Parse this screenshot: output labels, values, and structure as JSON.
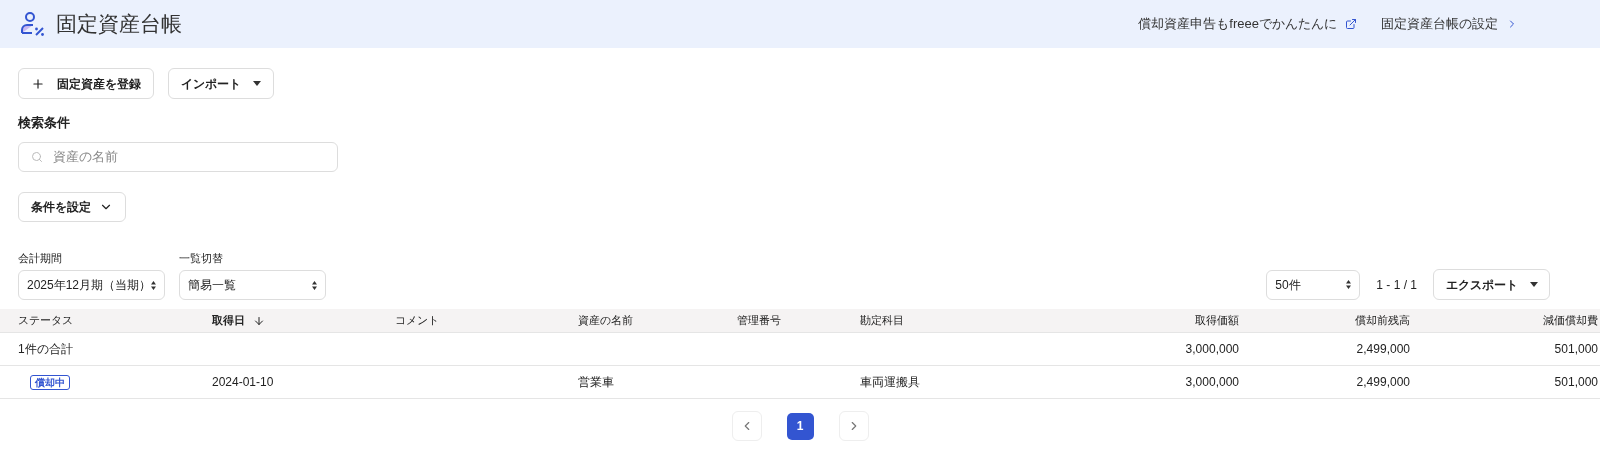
{
  "header": {
    "title": "固定資産台帳",
    "links": [
      {
        "label": "償却資産申告もfreeeでかんたんに",
        "kind": "external"
      },
      {
        "label": "固定資産台帳の設定",
        "kind": "chevron"
      }
    ]
  },
  "actions": [
    {
      "label": "固定資産を登録",
      "kind": "add"
    },
    {
      "label": "インポート",
      "kind": "dropdown"
    }
  ],
  "search": {
    "heading": "検索条件",
    "placeholder": "資産の名前",
    "filter_button": "条件を設定"
  },
  "selects": [
    {
      "label": "会計期間",
      "value": "2025年12月期（当期）"
    },
    {
      "label": "一覧切替",
      "value": "簡易一覧"
    }
  ],
  "per_page": "50件",
  "range": "1 - 1 / 1",
  "export": "エクスポート",
  "table": {
    "columns": [
      {
        "label": "ステータス",
        "kind": "text",
        "sorted": false
      },
      {
        "label": "取得日",
        "kind": "text",
        "sorted": true
      },
      {
        "label": "コメント",
        "kind": "text",
        "sorted": false
      },
      {
        "label": "資産の名前",
        "kind": "text",
        "sorted": false
      },
      {
        "label": "管理番号",
        "kind": "text",
        "sorted": false
      },
      {
        "label": "勘定科目",
        "kind": "text",
        "sorted": false
      },
      {
        "label": "取得価額",
        "kind": "amount",
        "sorted": false
      },
      {
        "label": "償却前残高",
        "kind": "amount",
        "sorted": false
      },
      {
        "label": "減価償却費",
        "kind": "amount",
        "sorted": false
      }
    ],
    "total": {
      "cells": [
        "1件の合計",
        "",
        "",
        "",
        "",
        "",
        "3,000,000",
        "2,499,000",
        "501,000"
      ]
    },
    "rows": [
      {
        "cells": [
          "償却中",
          "2024-01-10",
          "",
          "営業車",
          "",
          "車両運搬具",
          "3,000,000",
          "2,499,000",
          "501,000"
        ]
      }
    ]
  },
  "pagination": [
    {
      "label": "1",
      "selected": true
    }
  ]
}
